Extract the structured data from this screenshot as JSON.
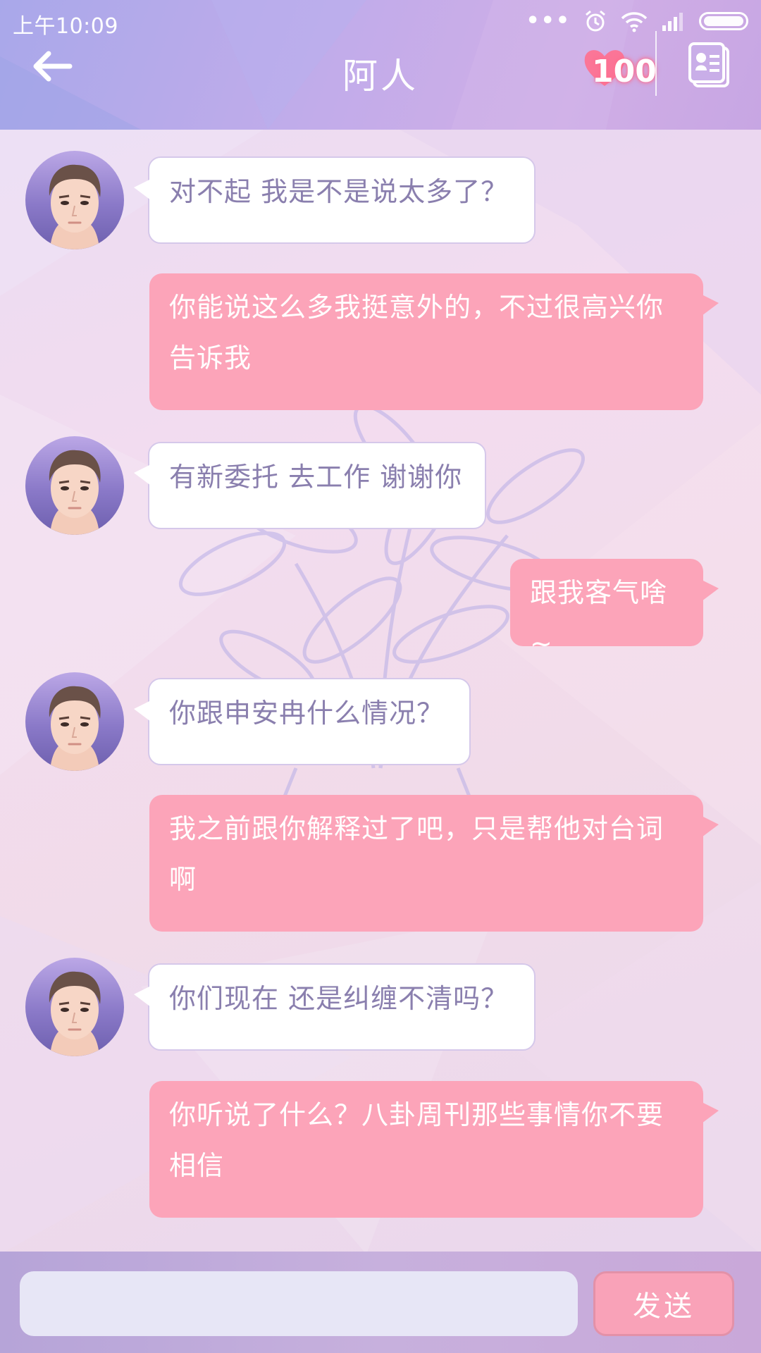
{
  "status_bar": {
    "time": "上午10:09",
    "dots": "•••"
  },
  "header": {
    "title": "阿人",
    "affection_value": "100"
  },
  "colors": {
    "bubble_in": "#ffffff",
    "bubble_out": "#fca4b9",
    "header": "#c2acea"
  },
  "messages": [
    {
      "from": "contact",
      "text": "对不起 我是不是说太多了？"
    },
    {
      "from": "me",
      "text": "你能说这么多我挺意外的，不过很高兴你告诉我"
    },
    {
      "from": "contact",
      "text": "有新委托 去工作 谢谢你"
    },
    {
      "from": "me",
      "text": "跟我客气啥~"
    },
    {
      "from": "contact",
      "text": "你跟申安冉什么情况？"
    },
    {
      "from": "me",
      "text": "我之前跟你解释过了吧，只是帮他对台词啊"
    },
    {
      "from": "contact",
      "text": "你们现在 还是纠缠不清吗？"
    },
    {
      "from": "me",
      "text": "你听说了什么？八卦周刊那些事情你不要相信"
    }
  ],
  "input": {
    "value": "",
    "placeholder": ""
  },
  "send_label": "发送"
}
